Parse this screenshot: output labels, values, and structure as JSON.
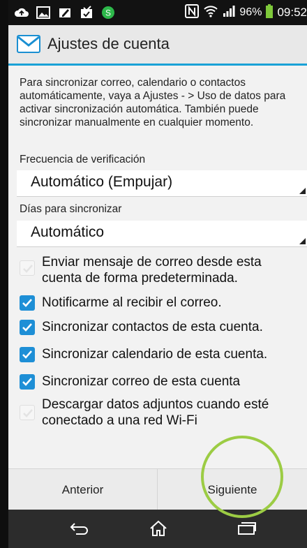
{
  "status_bar": {
    "icons_left": [
      "cloud-icon",
      "image-icon",
      "pen-icon",
      "inbox-check-icon",
      "app-green-icon"
    ],
    "nfc_icon": "nfc-icon",
    "battery": "96%",
    "time": "09:52"
  },
  "action_bar": {
    "title": "Ajustes de cuenta",
    "icon": "mail-icon"
  },
  "intro_text": "Para sincronizar correo, calendario o contactos automáticamente, vaya a Ajustes - > Uso de datos para activar sincronización automática. También puede sincronizar manualmente en cualquier momento.",
  "frequency": {
    "label": "Frecuencia de verificación",
    "value": "Automático (Empujar)"
  },
  "sync_days": {
    "label": "Días para sincronizar",
    "value": "Automático"
  },
  "checkboxes": [
    {
      "label": "Enviar mensaje de correo desde esta cuenta de forma predeterminada.",
      "checked": false,
      "enabled": false
    },
    {
      "label": "Notificarme al recibir el correo.",
      "checked": true,
      "enabled": true
    },
    {
      "label": "Sincronizar contactos de esta cuenta.",
      "checked": true,
      "enabled": true
    },
    {
      "label": "Sincronizar calendario de esta cuenta.",
      "checked": true,
      "enabled": true
    },
    {
      "label": "Sincronizar correo de esta cuenta",
      "checked": true,
      "enabled": true
    },
    {
      "label": "Descargar datos adjuntos cuando esté conectado a una red Wi-Fi",
      "checked": false,
      "enabled": false
    }
  ],
  "buttons": {
    "previous": "Anterior",
    "next": "Siguiente"
  },
  "nav_bar": {
    "icons": [
      "back-icon",
      "home-icon",
      "recents-icon"
    ]
  },
  "colors": {
    "accent": "#1aa1d6",
    "checkbox": "#1e8fd6",
    "highlight_circle": "#9ccc44"
  }
}
